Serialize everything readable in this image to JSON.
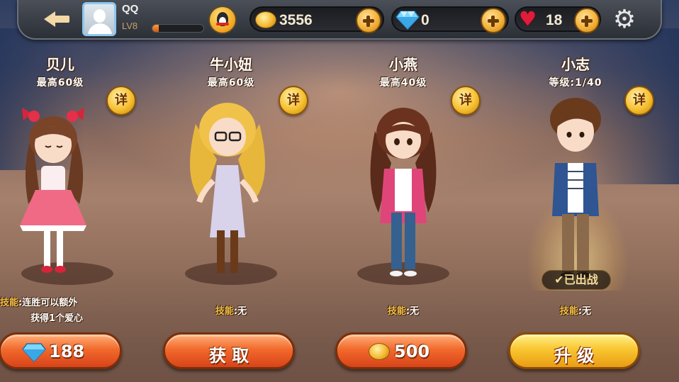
{
  "player": {
    "name": "QQ",
    "level": "LV8",
    "xp_fraction": 0.12
  },
  "resources": {
    "coins": "3556",
    "gems": "0",
    "hearts": "18"
  },
  "icons": {
    "back": "back-arrow-icon",
    "avatar": "default-avatar-icon",
    "qq": "qq-penguin-icon",
    "coin": "gold-coin-icon",
    "gem": "diamond-icon",
    "heart": "heart-icon",
    "plus": "plus-icon",
    "settings": "gear-icon"
  },
  "detail_label": "详",
  "characters": [
    {
      "name": "贝儿",
      "sub": "最高60级",
      "skill_label": "技能",
      "skill_text_line1": ":连胜可以额外",
      "skill_text_line2": "获得1个爱心",
      "button_value": "188",
      "button_icon": "diamond-icon"
    },
    {
      "name": "牛小妞",
      "sub": "最高60级",
      "skill_label": "技能",
      "skill_text_line1": ":无",
      "button_label": "获 取"
    },
    {
      "name": "小燕",
      "sub": "最高40级",
      "skill_label": "技能",
      "skill_text_line1": ":无",
      "button_value": "500",
      "button_icon": "gold-coin-icon"
    },
    {
      "name": "小志",
      "sub": "等级:1/40",
      "skill_label": "技能",
      "skill_text_line1": ":无",
      "status": "✔已出战",
      "button_label": "升 级"
    }
  ],
  "colors": {
    "button_red": "#f26a2c",
    "button_yellow": "#f9c630",
    "skill_label": "#f3c24a"
  }
}
